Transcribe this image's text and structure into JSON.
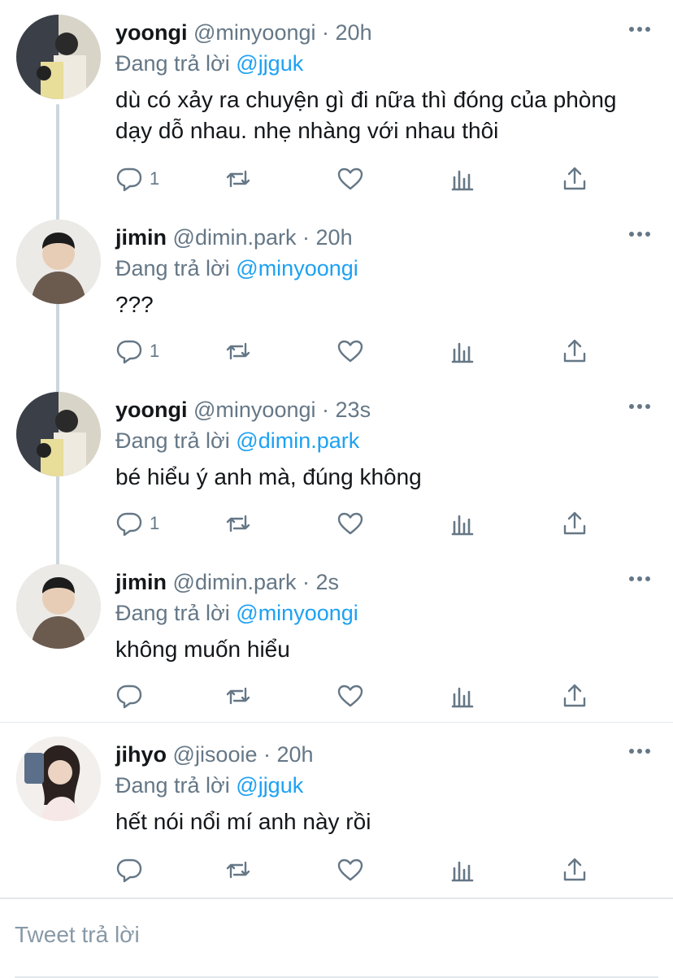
{
  "replying_prefix": "Đang trả lời",
  "tweets": [
    {
      "name": "yoongi",
      "handle": "@minyoongi",
      "dot": "·",
      "time": "20h",
      "reply_to": "@jjguk",
      "text": "dù có xảy ra chuyện gì đi nữa thì đóng của phòng dạy dỗ nhau. nhẹ nhàng với nhau thôi",
      "reply_count": "1"
    },
    {
      "name": "jimin",
      "handle": "@dimin.park",
      "dot": "·",
      "time": "20h",
      "reply_to": "@minyoongi",
      "text": "???",
      "reply_count": "1"
    },
    {
      "name": "yoongi",
      "handle": "@minyoongi",
      "dot": "·",
      "time": "23s",
      "reply_to": "@dimin.park",
      "text": "bé hiểu ý anh mà, đúng không",
      "reply_count": "1"
    },
    {
      "name": "jimin",
      "handle": "@dimin.park",
      "dot": "·",
      "time": "2s",
      "reply_to": "@minyoongi",
      "text": "không muốn hiểu",
      "reply_count": ""
    },
    {
      "name": "jihyo",
      "handle": "@jisooie",
      "dot": "·",
      "time": "20h",
      "reply_to": "@jjguk",
      "text": "hết nói nổi mí anh này rồi",
      "reply_count": ""
    }
  ],
  "reply_box": {
    "placeholder": "Tweet trả lời"
  },
  "icons": {
    "reply": "reply-icon",
    "retweet": "retweet-icon",
    "like": "heart-icon",
    "stats": "analytics-icon",
    "share": "share-icon",
    "more": "more-icon"
  },
  "colors": {
    "link": "#1da1f2",
    "muted": "#657786",
    "icon": "#657786",
    "line": "#ccd6dd"
  }
}
